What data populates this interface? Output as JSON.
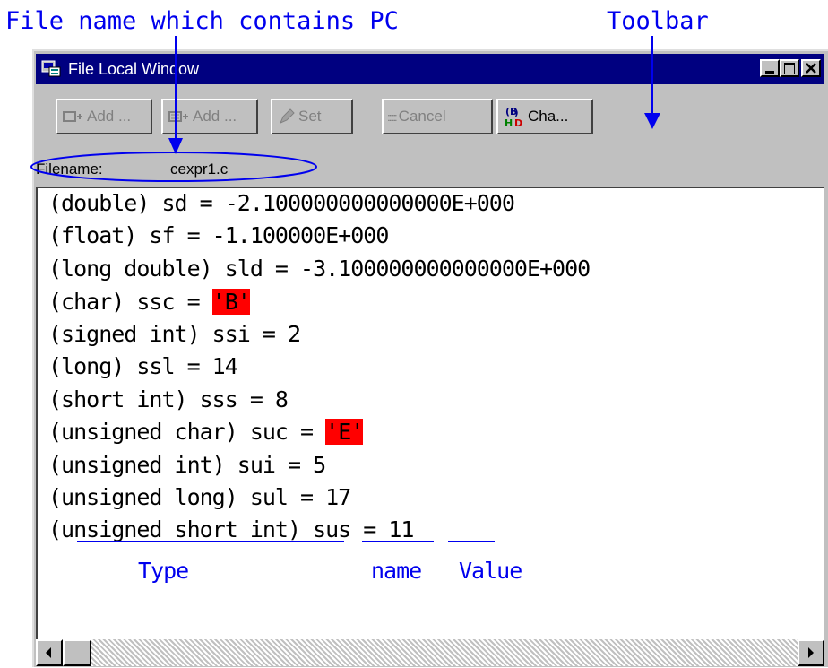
{
  "annotations": {
    "filename_callout": "File name which contains PC",
    "toolbar_callout": "Toolbar"
  },
  "window": {
    "title": "File Local Window",
    "controls": [
      "minimize",
      "maximize",
      "close"
    ]
  },
  "toolbar": {
    "buttons": [
      {
        "label": "Add ...",
        "icon": "add-watch-icon",
        "enabled": false
      },
      {
        "label": "Add ...",
        "icon": "add-watch-icon",
        "enabled": false
      },
      {
        "label": "Set",
        "icon": "pencil-icon",
        "enabled": false
      },
      {
        "label": "Cancel",
        "icon": "cancel-icon",
        "enabled": false
      },
      {
        "label": "Cha...",
        "icon": "radix-change-icon",
        "enabled": true
      }
    ]
  },
  "file": {
    "label": "Filename:",
    "value": "cexpr1.c"
  },
  "variables": [
    {
      "text": "(double) sd = -2.100000000000000E+000"
    },
    {
      "text": "(float) sf = -1.100000E+000"
    },
    {
      "text": "(long double) sld = -3.100000000000000E+000"
    },
    {
      "prefix": "(char) ssc = ",
      "value": "'B'"
    },
    {
      "text": "(signed int) ssi = 2"
    },
    {
      "text": "(long) ssl = 14"
    },
    {
      "text": "(short int) sss = 8"
    },
    {
      "prefix": "(unsigned char) suc = ",
      "value": "'E'"
    },
    {
      "text": "(unsigned int) sui = 5"
    },
    {
      "text": "(unsigned long) sul = 17"
    },
    {
      "text": "(unsigned short int) sus = 11"
    }
  ],
  "legend": {
    "type_label": "Type",
    "name_label": "name",
    "value_label": "Value"
  },
  "colors": {
    "annotation": "#0000ee",
    "titlebar": "#000080",
    "highlight": "#ff0000"
  }
}
